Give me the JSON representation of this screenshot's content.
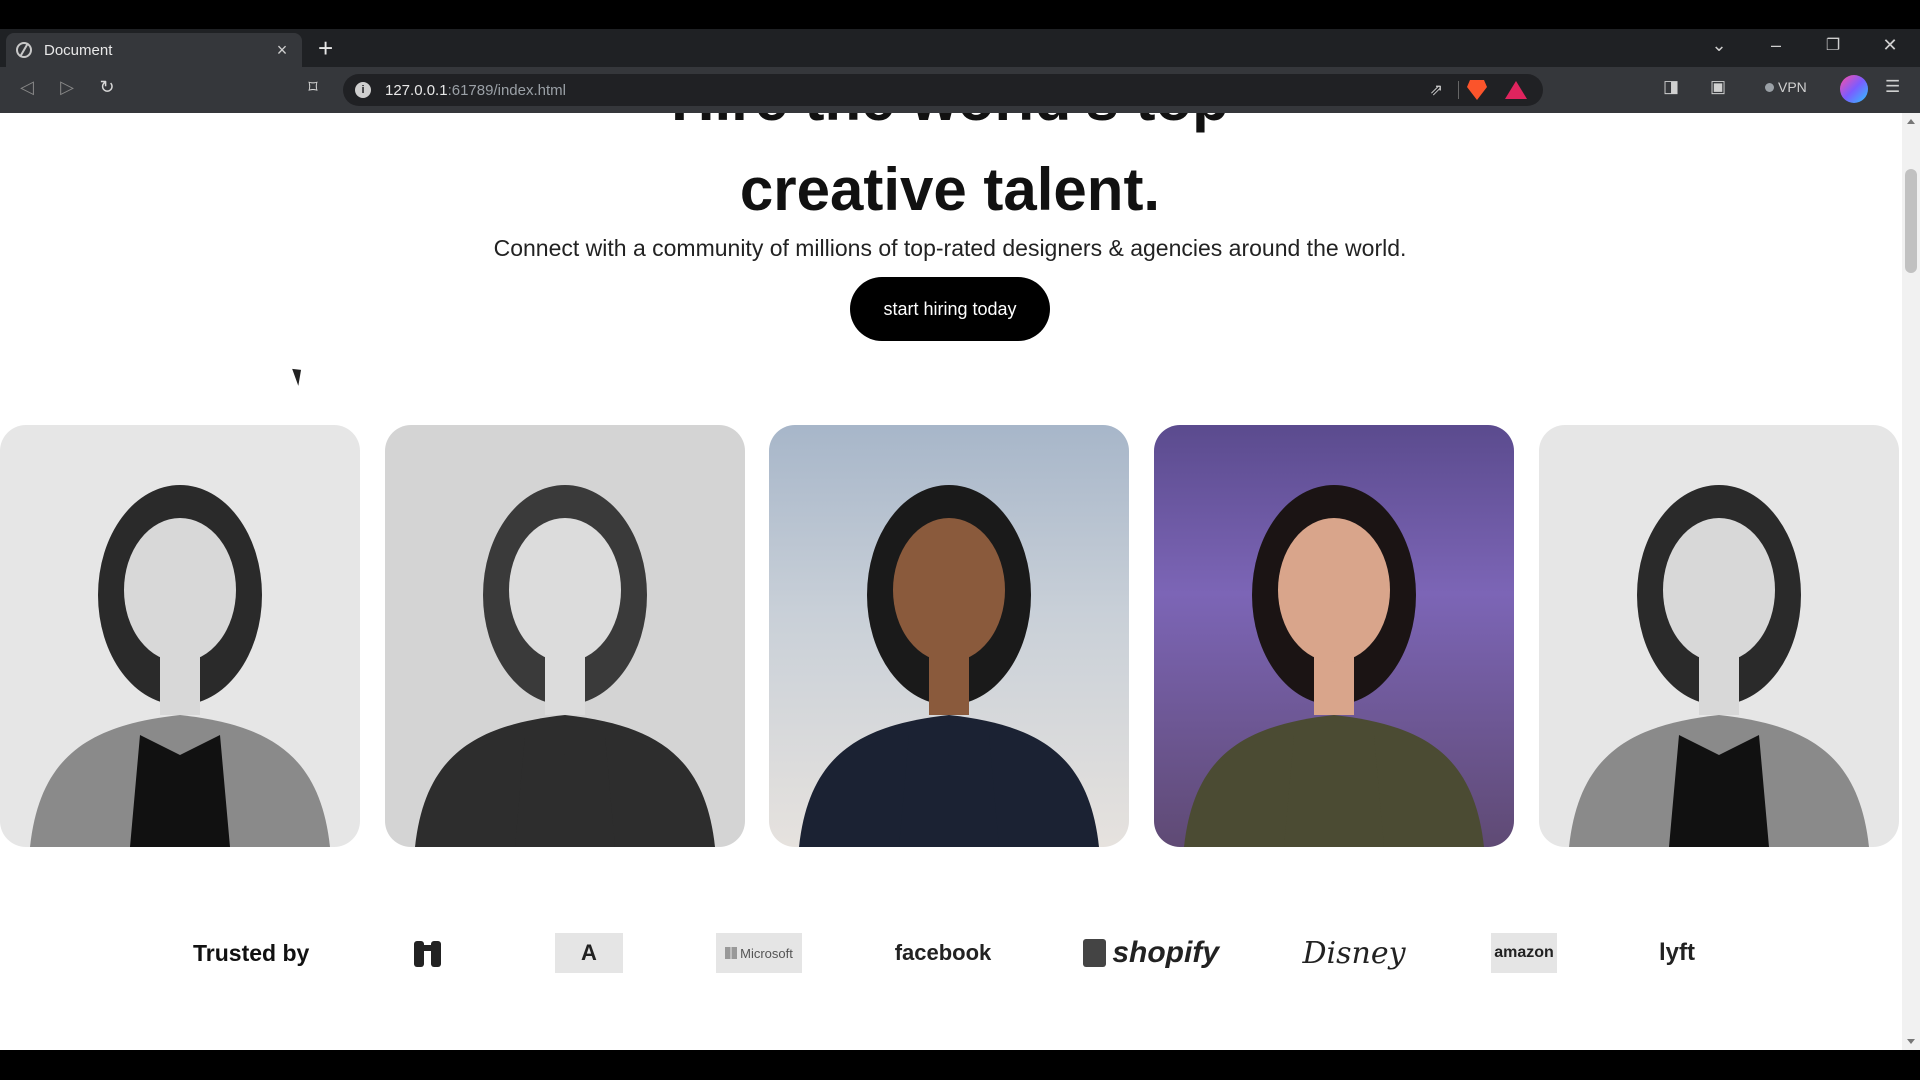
{
  "browser": {
    "tab_title": "Document",
    "url_host": "127.0.0.1",
    "url_path": ":61789/index.html",
    "vpn_label": "VPN"
  },
  "hero": {
    "title_line1": "Hire the world's top",
    "title_line2": "creative talent.",
    "subtitle": "Connect with a community of millions of top-rated designers & agencies around the world.",
    "cta_label": "start hiring today"
  },
  "cards": [
    {
      "style": "grayscale",
      "shirt": "#111111",
      "jacket": "#8a8a8a",
      "hair": "#2a2a2a",
      "skin": "#d8d8d8"
    },
    {
      "style": "grayscale",
      "shirt": "#2d2d2d",
      "jacket": "#2d2d2d",
      "hair": "#3a3a3a",
      "skin": "#dcdcdc"
    },
    {
      "style": "color",
      "shirt": "#1b2233",
      "jacket": "#1b2233",
      "hair": "#1a1a1a",
      "skin": "#8a5a3c"
    },
    {
      "style": "color",
      "shirt": "#4b4b33",
      "jacket": "#4b4b33",
      "hair": "#1b1414",
      "skin": "#d9a58b"
    },
    {
      "style": "grayscale",
      "shirt": "#111111",
      "jacket": "#8a8a8a",
      "hair": "#2a2a2a",
      "skin": "#d8d8d8"
    }
  ],
  "trusted": {
    "label": "Trusted by",
    "logos": {
      "adobe": "A",
      "microsoft": "Microsoft",
      "facebook": "facebook",
      "shopify": "shopify",
      "disney": "Disney",
      "amazon": "amazon",
      "lyft": "lyft"
    }
  }
}
